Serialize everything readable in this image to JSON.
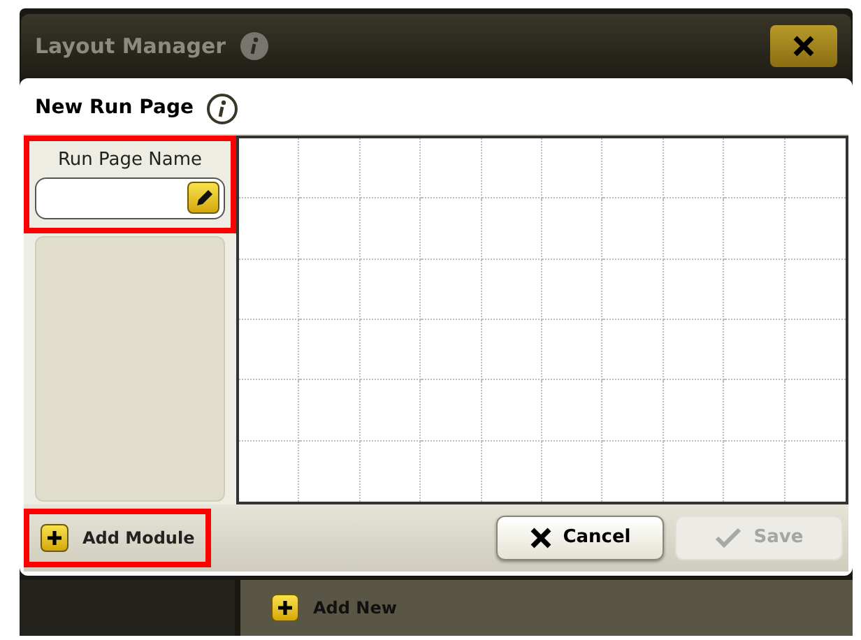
{
  "window": {
    "title": "Layout Manager"
  },
  "dialog": {
    "title": "New Run Page",
    "name_field": {
      "label": "Run Page Name",
      "highlighted": true
    },
    "add_module": {
      "label": "Add Module",
      "highlighted": true
    },
    "buttons": [
      {
        "kind": "cancel",
        "label": "Cancel",
        "disabled": false
      },
      {
        "kind": "save",
        "label": "Save",
        "disabled": true
      }
    ]
  },
  "background_bar": {
    "label": "Add New"
  }
}
